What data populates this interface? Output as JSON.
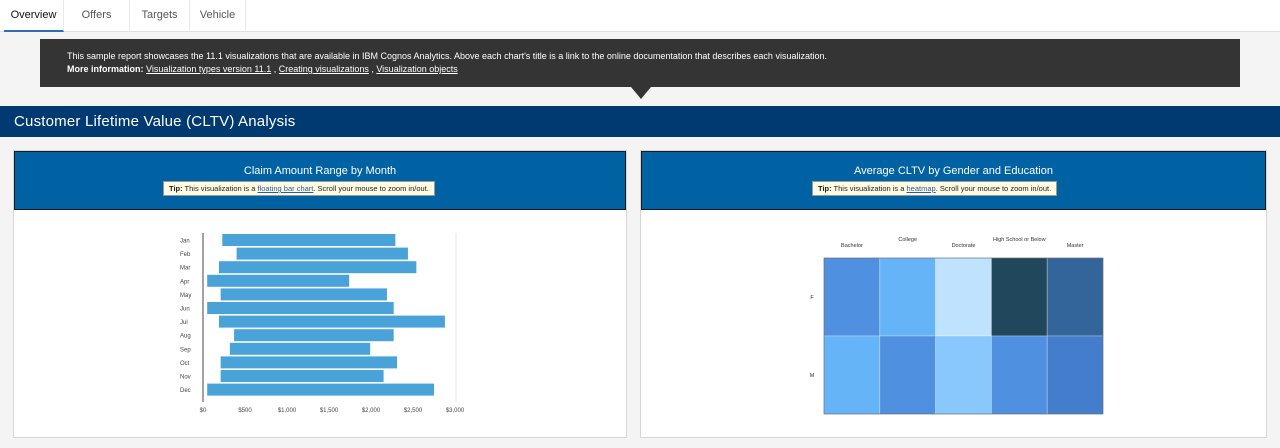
{
  "tabs": [
    {
      "label": "Overview",
      "active": true
    },
    {
      "label": "Offers",
      "active": false
    },
    {
      "label": "Targets",
      "active": false
    },
    {
      "label": "Vehicle",
      "active": false
    }
  ],
  "notice": {
    "text": "This sample report showcases the 11.1 visualizations that are available in IBM Cognos Analytics. Above each chart's title is a link to the online documentation that describes each visualization.",
    "more_label": "More information:",
    "link1": "Visualization types version 11.1",
    "sep1": " , ",
    "link2": "Creating visualizations",
    "sep2": " , ",
    "link3": "Visualization objects"
  },
  "banner": {
    "title": "Customer Lifetime Value (CLTV) Analysis"
  },
  "card_left": {
    "title": "Claim Amount Range by Month",
    "tip_label": "Tip:",
    "tip_pre": " This visualization is a ",
    "tip_link": "floating bar chart",
    "tip_post": ". Scroll your mouse to zoom in/out."
  },
  "card_right": {
    "title": "Average CLTV by Gender and Education",
    "tip_label": "Tip:",
    "tip_pre": " This visualization is a ",
    "tip_link": "heatmap",
    "tip_post": ". Scroll your mouse to zoom in/out."
  },
  "colors": {
    "bar": "#4aa3d8",
    "banner": "#003a70",
    "card_head": "#0062a3"
  },
  "chart_data": [
    {
      "type": "bar",
      "orientation": "horizontal-floating",
      "title": "Claim Amount Range by Month",
      "categories": [
        "Jan",
        "Feb",
        "Mar",
        "Apr",
        "May",
        "Jun",
        "Jul",
        "Aug",
        "Sep",
        "Oct",
        "Nov",
        "Dec"
      ],
      "ranges": [
        [
          230,
          2290
        ],
        [
          400,
          2440
        ],
        [
          190,
          2540
        ],
        [
          50,
          1740
        ],
        [
          210,
          2190
        ],
        [
          50,
          2270
        ],
        [
          190,
          2880
        ],
        [
          370,
          2270
        ],
        [
          320,
          1990
        ],
        [
          210,
          2310
        ],
        [
          210,
          2150
        ],
        [
          50,
          2750
        ]
      ],
      "xticks": [
        "$0",
        "$500",
        "$1,000",
        "$1,500",
        "$2,000",
        "$2,500",
        "$3,000"
      ],
      "xlim": [
        0,
        3000
      ],
      "grid": false
    },
    {
      "type": "heatmap",
      "title": "Average CLTV by Gender and Education",
      "columns": [
        "Bachelor",
        "College",
        "Doctorate",
        "High School or Below",
        "Master"
      ],
      "rows": [
        "F",
        "M"
      ],
      "cell_colors": [
        [
          "#4f90e0",
          "#66b4f8",
          "#bfe3fe",
          "#21475c",
          "#33649a"
        ],
        [
          "#66b4f8",
          "#4f90e0",
          "#88c8fc",
          "#4f90e0",
          "#447dcc"
        ]
      ]
    }
  ]
}
